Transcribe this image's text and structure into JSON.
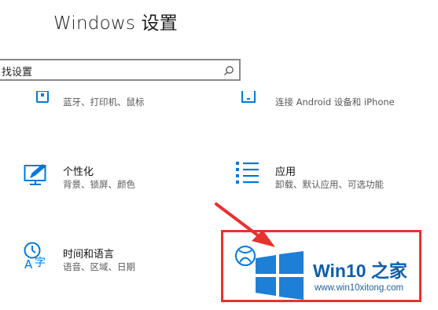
{
  "window": {
    "title": "Windows 设置"
  },
  "search": {
    "value": "找设置"
  },
  "tiles": [
    {
      "icon": "devices-icon",
      "desc": "蓝牙、打印机、鼠标"
    },
    {
      "icon": "phone-icon",
      "desc": "连接 Android 设备和 iPhone"
    },
    {
      "icon": "personalization-icon",
      "title": "个性化",
      "desc": "背景、锁屏、颜色"
    },
    {
      "icon": "apps-icon",
      "title": "应用",
      "desc": "卸载、默认应用、可选功能"
    },
    {
      "icon": "time-language-icon",
      "title": "时间和语言",
      "desc": "语音、区域、日期"
    },
    {
      "icon": "xbox-icon"
    }
  ],
  "watermark": {
    "title": "Win10 之家",
    "url": "www.win10xitong.com"
  },
  "colors": {
    "accent": "#0078d7",
    "highlight": "#e8322e",
    "watermark": "#0f5ea8"
  }
}
